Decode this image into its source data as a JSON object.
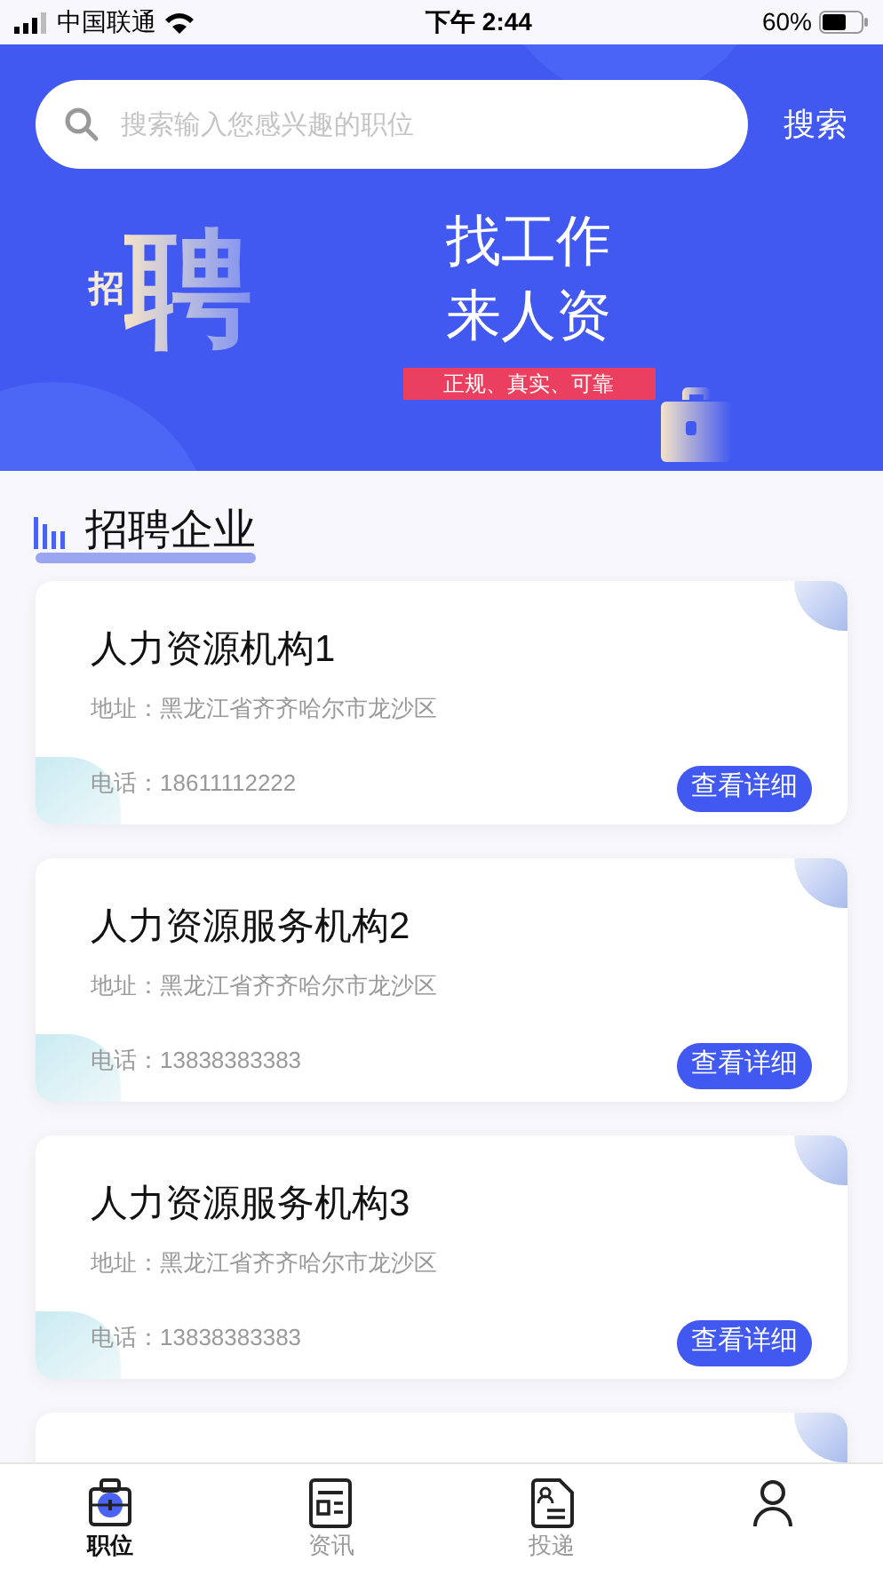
{
  "status_bar": {
    "carrier": "中国联通",
    "time": "下午 2:44",
    "battery": "60%"
  },
  "search": {
    "placeholder": "搜索输入您感兴趣的职位",
    "button": "搜索"
  },
  "banner": {
    "art_big": "聘",
    "art_small": "招",
    "title_lines": [
      "找工作",
      "来人资"
    ],
    "tag": "正规、真实、可靠"
  },
  "section_title": "招聘企业",
  "companies": [
    {
      "name": "人力资源机构1",
      "address": "地址：黑龙江省齐齐哈尔市龙沙区",
      "phone": "电话：18611112222",
      "button": "查看详细"
    },
    {
      "name": "人力资源服务机构2",
      "address": "地址：黑龙江省齐齐哈尔市龙沙区",
      "phone": "电话：13838383383",
      "button": "查看详细"
    },
    {
      "name": "人力资源服务机构3",
      "address": "地址：黑龙江省齐齐哈尔市龙沙区",
      "phone": "电话：13838383383",
      "button": "查看详细"
    }
  ],
  "tabs": [
    {
      "kind": "jobs",
      "label": "职位",
      "selected": true
    },
    {
      "kind": "news",
      "label": "资讯",
      "selected": false
    },
    {
      "kind": "resume",
      "label": "投递",
      "selected": false
    },
    {
      "kind": "profile",
      "selected": false
    }
  ]
}
